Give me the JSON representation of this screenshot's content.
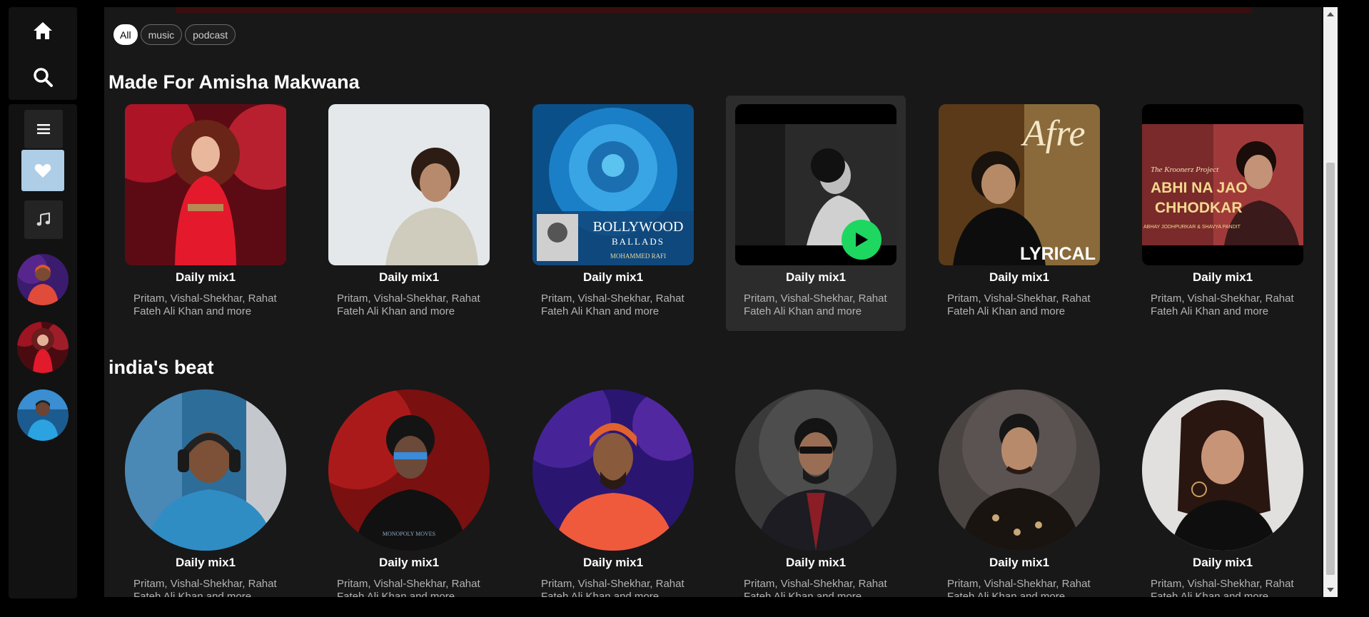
{
  "filters": [
    "All",
    "music",
    "podcast"
  ],
  "sections": [
    {
      "title": "Made For Amisha Makwana",
      "cards": [
        {
          "title": "Daily mix1",
          "subtitle": "Pritam, Vishal-Shekhar, Rahat Fateh Ali Khan and more"
        },
        {
          "title": "Daily mix1",
          "subtitle": "Pritam, Vishal-Shekhar, Rahat Fateh Ali Khan and more"
        },
        {
          "title": "Daily mix1",
          "subtitle": "Pritam, Vishal-Shekhar, Rahat Fateh Ali Khan and more",
          "cover_text_1": "BOLLYWOOD",
          "cover_text_2": "BALLADS",
          "cover_text_3": "MOHAMMED RAFI"
        },
        {
          "title": "Daily mix1",
          "subtitle": "Pritam, Vishal-Shekhar, Rahat Fateh Ali Khan and more"
        },
        {
          "title": "Daily mix1",
          "subtitle": "Pritam, Vishal-Shekhar, Rahat Fateh Ali Khan and more",
          "cover_text_1": "Afre",
          "cover_text_2": "LYRICAL"
        },
        {
          "title": "Daily mix1",
          "subtitle": "Pritam, Vishal-Shekhar, Rahat Fateh Ali Khan and more",
          "cover_text_1": "The Kroonerz Project",
          "cover_text_2": "ABHI NA JAO",
          "cover_text_3": "CHHODKAR",
          "cover_text_4": "ABHAY JODHPURKAR & SHAVYA PANDIT"
        }
      ]
    },
    {
      "title": "india's beat",
      "cards": [
        {
          "title": "Daily mix1",
          "subtitle": "Pritam, Vishal-Shekhar, Rahat Fateh Ali Khan and more"
        },
        {
          "title": "Daily mix1",
          "subtitle": "Pritam, Vishal-Shekhar, Rahat Fateh Ali Khan and more",
          "cover_text_1": "MONOPOLY MOVES"
        },
        {
          "title": "Daily mix1",
          "subtitle": "Pritam, Vishal-Shekhar, Rahat Fateh Ali Khan and more"
        },
        {
          "title": "Daily mix1",
          "subtitle": "Pritam, Vishal-Shekhar, Rahat Fateh Ali Khan and more"
        },
        {
          "title": "Daily mix1",
          "subtitle": "Pritam, Vishal-Shekhar, Rahat Fateh Ali Khan and more"
        },
        {
          "title": "Daily mix1",
          "subtitle": "Pritam, Vishal-Shekhar, Rahat Fateh Ali Khan and more"
        }
      ]
    }
  ],
  "icons": {
    "home": "home-icon",
    "search": "search-icon",
    "library": "menu-icon",
    "liked": "heart-icon",
    "music": "music-note-icon",
    "play": "play-icon"
  },
  "colors": {
    "accent": "#1ed760",
    "liked_bg": "#aecde6",
    "background": "#181818",
    "sidebar": "#121212"
  }
}
